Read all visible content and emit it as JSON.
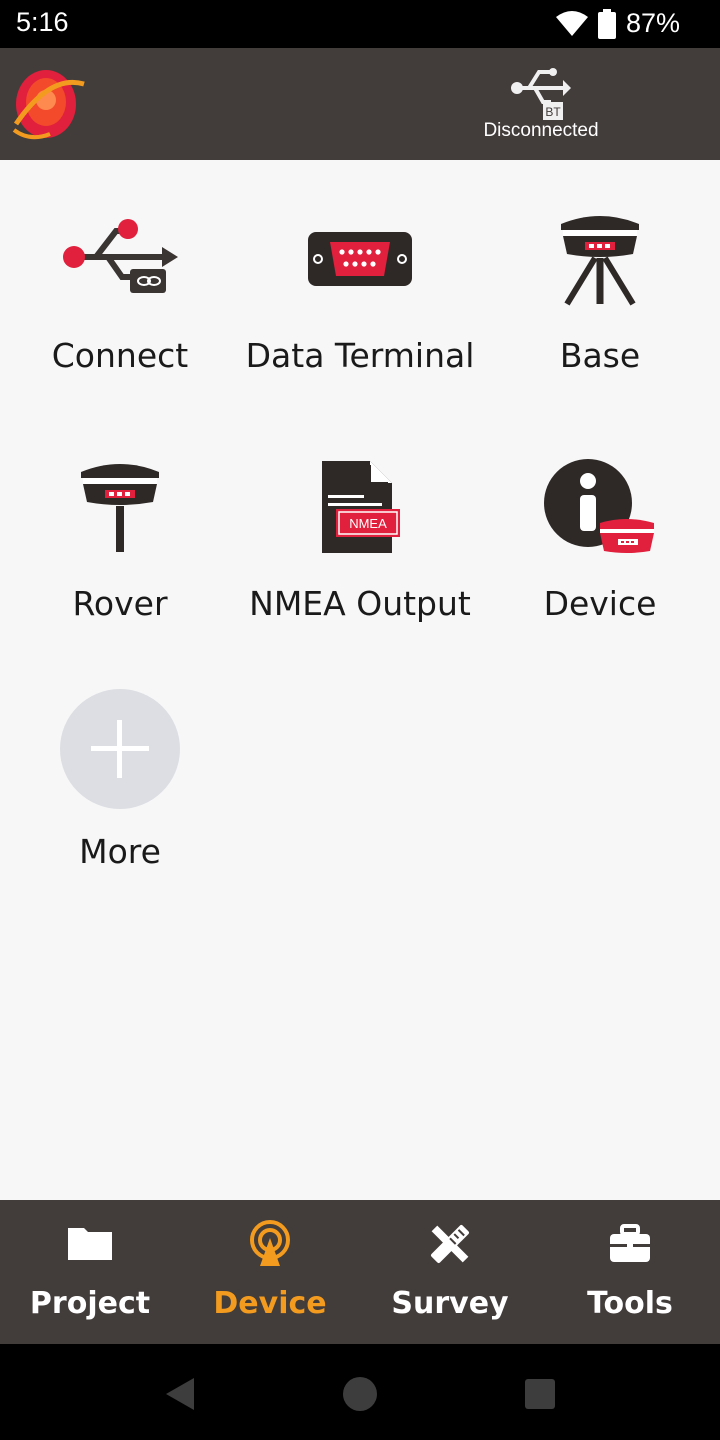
{
  "status_bar": {
    "time": "5:16",
    "battery": "87%"
  },
  "app_bar": {
    "connection_status": "Disconnected",
    "connection_badge": "BT"
  },
  "grid": {
    "items": [
      {
        "label": "Connect"
      },
      {
        "label": "Data Terminal"
      },
      {
        "label": "Base"
      },
      {
        "label": "Rover"
      },
      {
        "label": "NMEA Output",
        "badge": "NMEA"
      },
      {
        "label": "Device"
      },
      {
        "label": "More"
      }
    ]
  },
  "bottom_nav": {
    "items": [
      {
        "label": "Project"
      },
      {
        "label": "Device"
      },
      {
        "label": "Survey"
      },
      {
        "label": "Tools"
      }
    ],
    "active": "Device"
  },
  "colors": {
    "accent": "#f29b1e",
    "bar": "#423c3a",
    "red": "#e0203c"
  }
}
